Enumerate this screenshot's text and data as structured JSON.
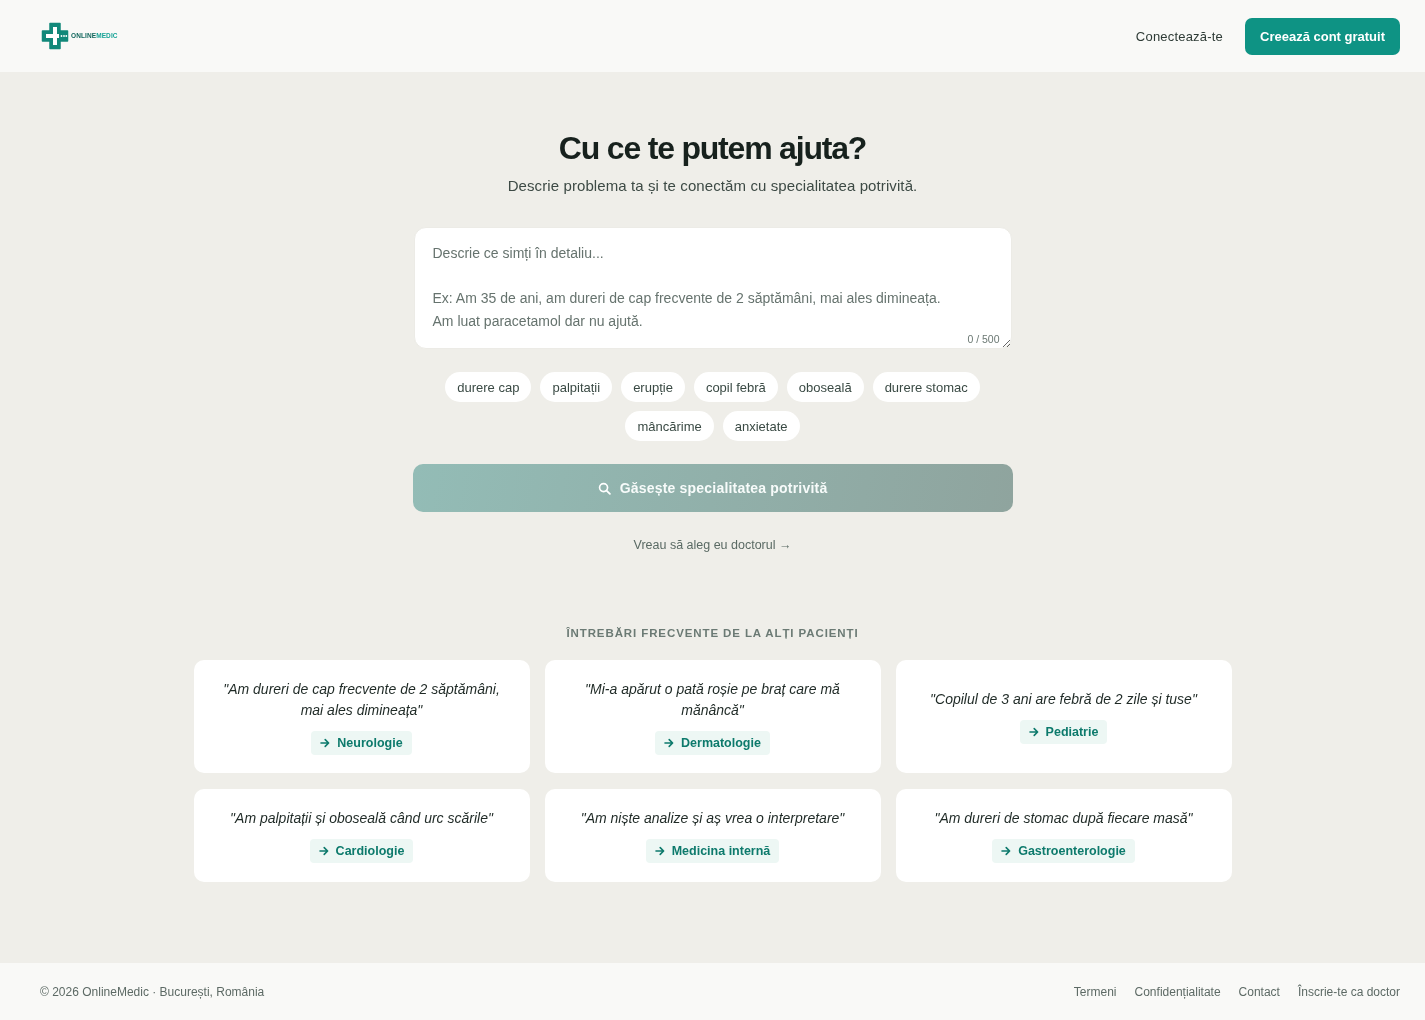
{
  "header": {
    "logo": {
      "name_part1": "ONLINE",
      "name_part2": "MEDIC"
    },
    "login_link": "Conectează-te",
    "signup_button": "Creează cont gratuit"
  },
  "hero": {
    "title": "Cu ce te putem ajuta?",
    "subtitle": "Descrie problema ta și te conectăm cu specialitatea potrivită."
  },
  "symptom_field": {
    "placeholder": "Descrie ce simți în detaliu...\n\nEx: Am 35 de ani, am dureri de cap frecvente de 2 săptămâni, mai ales dimineața.\nAm luat paracetamol dar nu ajută.",
    "counter": "0 / 500"
  },
  "suggestion_chips": [
    "durere cap",
    "palpitații",
    "erupție",
    "copil febră",
    "oboseală",
    "durere stomac",
    "mâncărime",
    "anxietate"
  ],
  "find_button": {
    "label": "Găsește specialitatea potrivită",
    "disabled": true
  },
  "choose_doctor_link": "Vreau să aleg eu doctorul →",
  "faq": {
    "heading": "ÎNTREBĂRI FRECVENTE DE LA ALȚI PACIENȚI",
    "examples": [
      {
        "quote": "\"Am dureri de cap frecvente de 2 săptămâni, mai ales dimineața\"",
        "specialty": "Neurologie"
      },
      {
        "quote": "\"Mi-a apărut o pată roșie pe braț care mă mănâncă\"",
        "specialty": "Dermatologie"
      },
      {
        "quote": "\"Copilul de 3 ani are febră de 2 zile și tuse\"",
        "specialty": "Pediatrie"
      },
      {
        "quote": "\"Am palpitații și oboseală când urc scările\"",
        "specialty": "Cardiologie"
      },
      {
        "quote": "\"Am niște analize și aș vrea o interpretare\"",
        "specialty": "Medicina internă"
      },
      {
        "quote": "\"Am dureri de stomac după fiecare masă\"",
        "specialty": "Gastroenterologie"
      }
    ]
  },
  "footer": {
    "copyright": "© 2026 OnlineMedic · București, România",
    "links": [
      "Termeni",
      "Confidențialitate",
      "Contact",
      "Înscrie-te ca doctor"
    ]
  }
}
